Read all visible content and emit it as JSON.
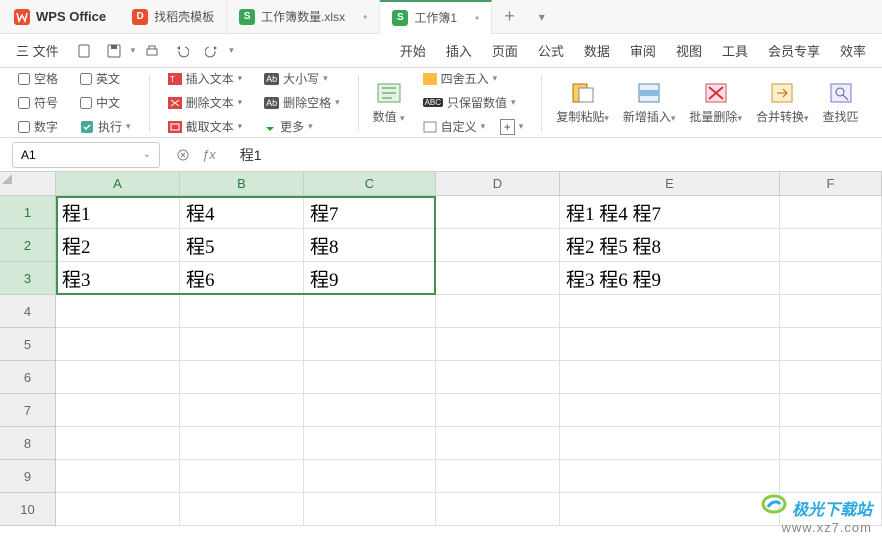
{
  "app_name": "WPS Office",
  "tabs": [
    {
      "label": "找稻壳模板",
      "icon_bg": "#e94f2e"
    },
    {
      "label": "工作簿数量.xlsx",
      "icon_bg": "#3aa655"
    },
    {
      "label": "工作簿1",
      "icon_bg": "#3aa655"
    }
  ],
  "file_menu": "三 文件",
  "top_menu": [
    "开始",
    "插入",
    "页面",
    "公式",
    "数据",
    "审阅",
    "视图",
    "工具",
    "会员专享",
    "效率"
  ],
  "options_col1": [
    "空格",
    "符号",
    "数字"
  ],
  "options_col2_a": "英文",
  "options_col2_b": "中文",
  "options_col2_c": "执行",
  "ribbon_text_group": {
    "insert": "插入文本",
    "delete": "删除文本",
    "extract": "截取文本"
  },
  "ribbon_ops": {
    "case": "大小写",
    "del_space": "删除空格",
    "more": "更多"
  },
  "ribbon_num": {
    "value": "数值",
    "round": "四舍五入",
    "keep": "只保留数值",
    "custom": "自定义"
  },
  "ribbon_actions": [
    "复制粘贴",
    "新增插入",
    "批量删除",
    "合并转换",
    "查找匹"
  ],
  "name_box": "A1",
  "fx_value": "程1",
  "columns": [
    "A",
    "B",
    "C",
    "D",
    "E",
    "F"
  ],
  "rows": [
    "1",
    "2",
    "3",
    "4",
    "5",
    "6",
    "7",
    "8",
    "9",
    "10"
  ],
  "cells": {
    "A1": "程1",
    "B1": "程4",
    "C1": "程7",
    "E1": "程1  程4  程7",
    "A2": "程2",
    "B2": "程5",
    "C2": "程8",
    "E2": "程2  程5  程8",
    "A3": "程3",
    "B3": "程6",
    "C3": "程9",
    "E3": "程3  程6  程9"
  },
  "watermark": {
    "brand": "极光下载站",
    "url": "www.xz7.com"
  }
}
